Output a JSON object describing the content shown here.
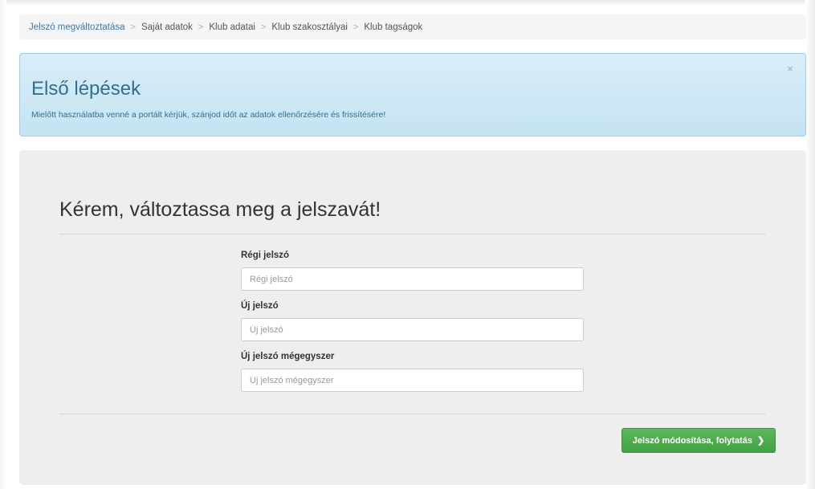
{
  "breadcrumb": {
    "items": [
      {
        "label": "Jelszó megváltoztatása"
      },
      {
        "label": "Saját adatok"
      },
      {
        "label": "Klub adatai"
      },
      {
        "label": "Klub szakosztályai"
      },
      {
        "label": "Klub tagságok"
      }
    ],
    "separator": ">"
  },
  "alert": {
    "title": "Első lépések",
    "text": "Mielőtt használatba venné a portált kérjük, szánjod időt az adatok ellenőrzésére és frissítésére!",
    "close_glyph": "×"
  },
  "form": {
    "title": "Kérem, változtassa meg a jelszavát!",
    "fields": [
      {
        "label": "Régi jelszó",
        "placeholder": "Régi jelszó",
        "value": ""
      },
      {
        "label": "Új jelszó",
        "placeholder": "Új jelszó",
        "value": ""
      },
      {
        "label": "Új jelszó mégegyszer",
        "placeholder": "Új jelszó mégegyszer",
        "value": ""
      }
    ],
    "submit_label": "Jelszó módosítása, folytatás",
    "submit_icon": "❯"
  },
  "colors": {
    "link": "#337ab7",
    "alert_bg": "#d9edf7",
    "alert_text": "#31708f",
    "button_green": "#5cb85c",
    "card_bg": "#eeeeee"
  },
  "icons": {
    "close": "close-icon",
    "submit": "chevron-right-icon"
  }
}
